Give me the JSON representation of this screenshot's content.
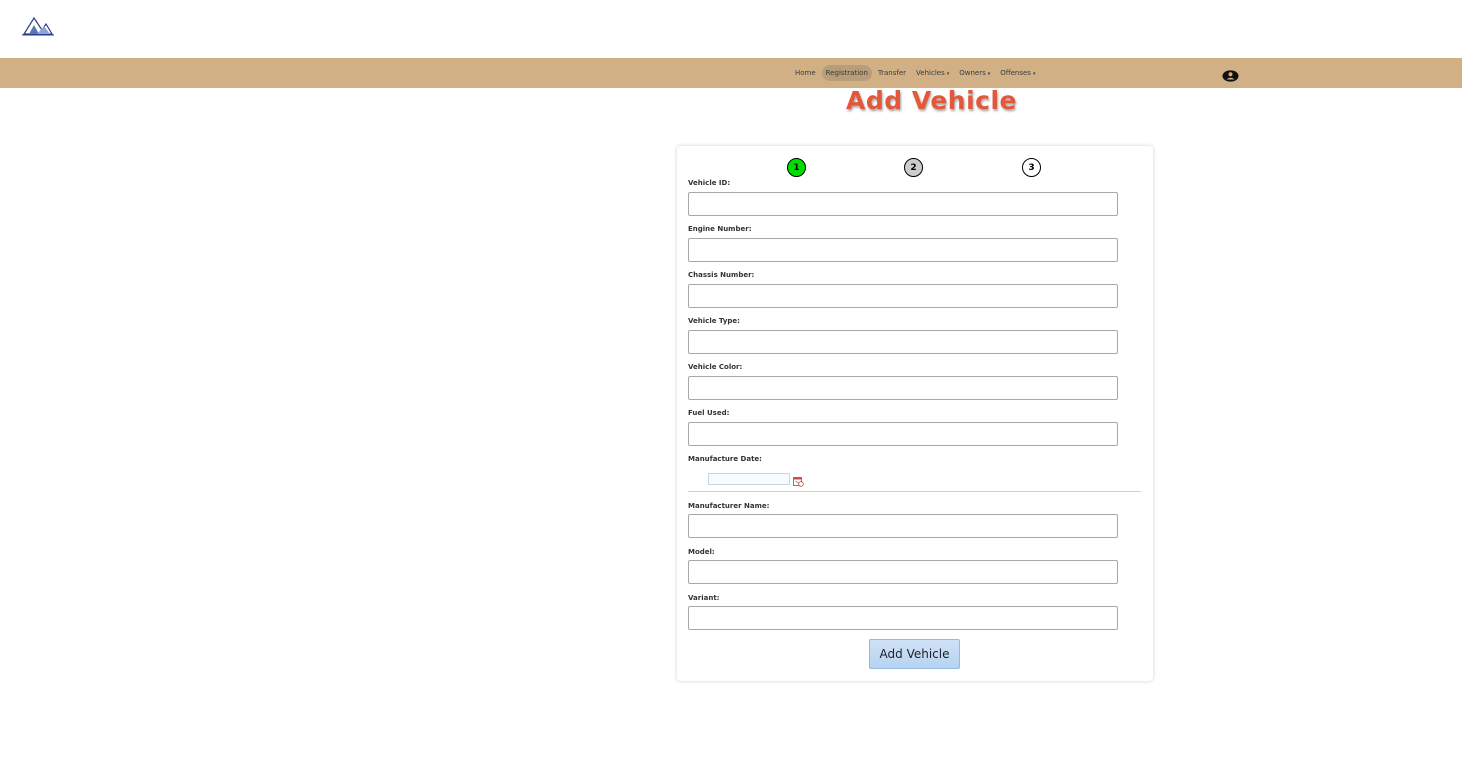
{
  "logo": {
    "icon": "mountain-logo",
    "caption": ""
  },
  "nav": {
    "items": [
      {
        "label": "Home",
        "active": false,
        "dropdown": false
      },
      {
        "label": "Registration",
        "active": true,
        "dropdown": false
      },
      {
        "label": "Transfer",
        "active": false,
        "dropdown": false
      },
      {
        "label": "Vehicles",
        "active": false,
        "dropdown": true
      },
      {
        "label": "Owners",
        "active": false,
        "dropdown": true
      },
      {
        "label": "Offenses",
        "active": false,
        "dropdown": true
      }
    ],
    "user_icon": "user-circle-icon",
    "bar_color": "#d2b086"
  },
  "page": {
    "title": "Add Vehicle",
    "title_color": "#e3583a"
  },
  "steps": [
    {
      "label": "1",
      "state": "current",
      "color": "#00dd00"
    },
    {
      "label": "2",
      "state": "pending",
      "color": "#cccccc"
    },
    {
      "label": "3",
      "state": "pending",
      "color": "#ffffff"
    }
  ],
  "form": {
    "fields": [
      {
        "label": "Vehicle ID:",
        "value": ""
      },
      {
        "label": "Engine Number:",
        "value": ""
      },
      {
        "label": "Chassis Number:",
        "value": ""
      },
      {
        "label": "Vehicle Type:",
        "value": ""
      },
      {
        "label": "Vehicle Color:",
        "value": ""
      },
      {
        "label": "Fuel Used:",
        "value": ""
      }
    ],
    "manufacture_date": {
      "label": "Manufacture Date:",
      "value": "",
      "icon": "calendar-icon"
    },
    "fields2": [
      {
        "label": "Manufacturer Name:",
        "value": ""
      },
      {
        "label": "Model:",
        "value": ""
      },
      {
        "label": "Variant:",
        "value": ""
      }
    ],
    "submit_label": "Add Vehicle"
  }
}
